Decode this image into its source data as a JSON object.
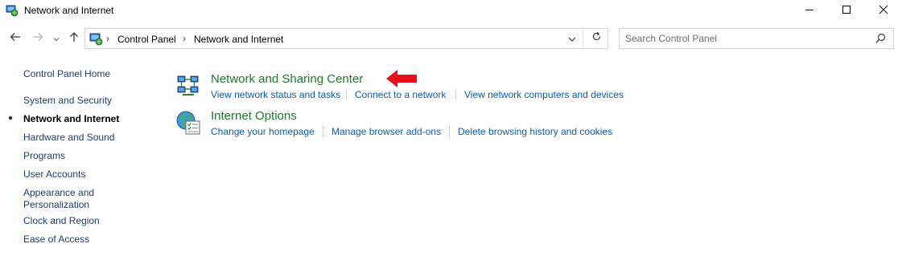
{
  "window": {
    "title": "Network and Internet",
    "controls": [
      "minimize",
      "maximize",
      "close"
    ]
  },
  "nav": {
    "back_icon": "arrow-left-icon",
    "forward_icon": "arrow-right-icon",
    "recent_icon": "chevron-down-icon",
    "up_icon": "arrow-up-icon"
  },
  "address": {
    "crumbs": [
      "Control Panel",
      "Network and Internet"
    ]
  },
  "search": {
    "placeholder": "Search Control Panel"
  },
  "sidebar": {
    "items": [
      {
        "label": "Control Panel Home"
      },
      {
        "label": "System and Security"
      },
      {
        "label": "Network and Internet",
        "active": true
      },
      {
        "label": "Hardware and Sound"
      },
      {
        "label": "Programs"
      },
      {
        "label": "User Accounts"
      },
      {
        "label": "Appearance and Personalization"
      },
      {
        "label": "Clock and Region"
      },
      {
        "label": "Ease of Access"
      }
    ]
  },
  "categories": [
    {
      "title": "Network and Sharing Center",
      "icon": "network-sharing-icon",
      "tasks": [
        "View network status and tasks",
        "Connect to a network",
        "View network computers and devices"
      ]
    },
    {
      "title": "Internet Options",
      "icon": "internet-options-icon",
      "tasks": [
        "Change your homepage",
        "Manage browser add-ons",
        "Delete browsing history and cookies"
      ]
    }
  ],
  "annotation": {
    "icon": "red-arrow-icon",
    "color": "#e8101a"
  },
  "colors": {
    "category_title": "#1e7b2a",
    "task_link": "#0d5bb0",
    "nav_link": "#1e3d6e"
  }
}
